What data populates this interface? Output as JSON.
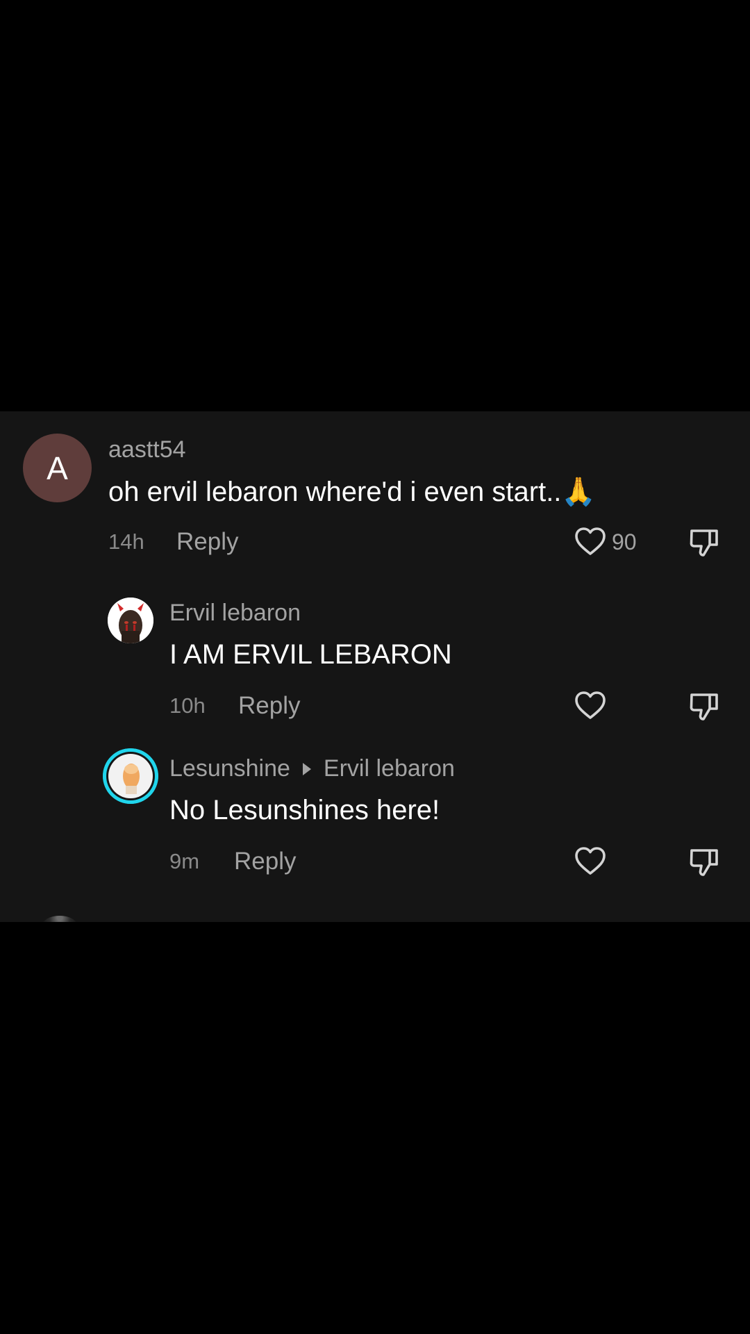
{
  "comments": [
    {
      "avatar_letter": "A",
      "avatar_color": "#5f3d3b",
      "username": "aastt54",
      "text": "oh ervil lebaron where'd i even start..🙏",
      "time": "14h",
      "reply_label": "Reply",
      "likes": "90"
    },
    {
      "username": "Ervil lebaron",
      "text": "I AM ERVIL LEBARON",
      "time": "10h",
      "reply_label": "Reply",
      "avatar_icon": "devil-avatar-icon"
    },
    {
      "username": "Lesunshine",
      "reply_to": "Ervil lebaron",
      "text": "No Lesunshines here!",
      "time": "9m",
      "reply_label": "Reply",
      "avatar_ring_color": "#20d5ec",
      "avatar_icon": "profile-photo-icon"
    }
  ],
  "colors": {
    "panel_bg": "#151515",
    "page_bg": "#000000",
    "username": "#a3a3a3",
    "text": "#ffffff"
  }
}
